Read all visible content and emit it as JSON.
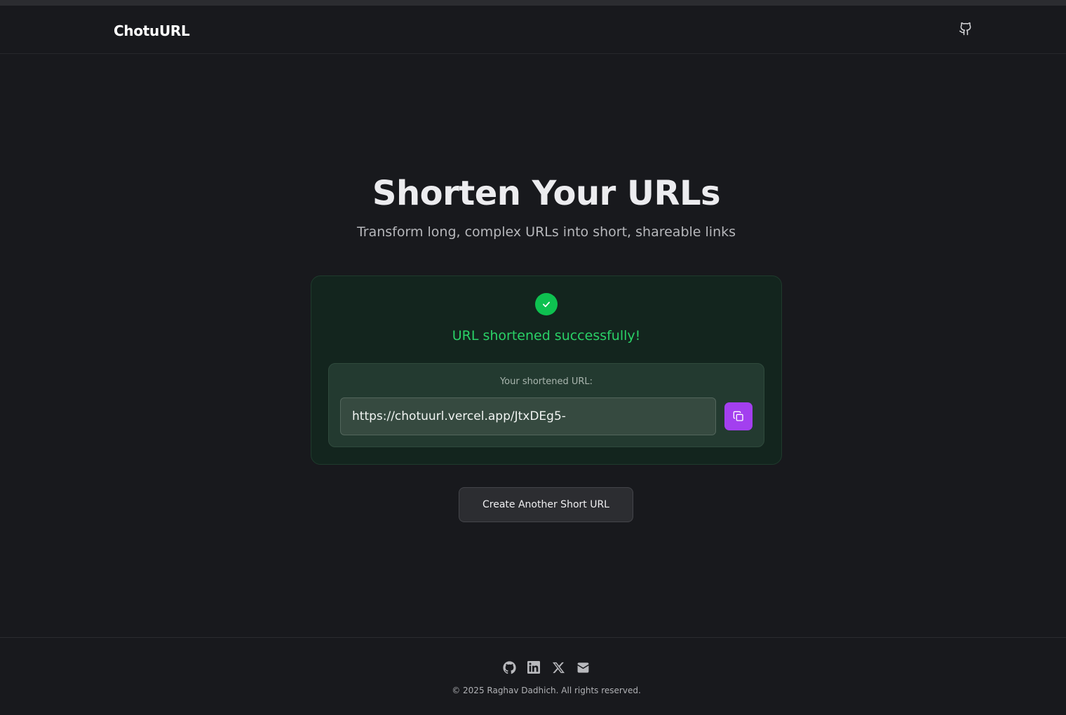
{
  "header": {
    "brand": "ChotuURL",
    "github_icon": "github-icon"
  },
  "hero": {
    "title": "Shorten Your URLs",
    "subtitle": "Transform long, complex URLs into short, shareable links"
  },
  "result": {
    "status_icon": "check-icon",
    "message": "URL shortened successfully!",
    "label": "Your shortened URL:",
    "short_url": "https://chotuurl.vercel.app/JtxDEg5-",
    "copy_icon": "copy-icon"
  },
  "actions": {
    "create_another_label": "Create Another Short URL"
  },
  "footer": {
    "icons": [
      "github-icon",
      "linkedin-icon",
      "x-icon",
      "mail-icon"
    ],
    "copyright": "© 2025 Raghav Dadhich. All rights reserved."
  },
  "colors": {
    "background": "#18191d",
    "success": "#0ec150",
    "accent": "#a33fef"
  }
}
